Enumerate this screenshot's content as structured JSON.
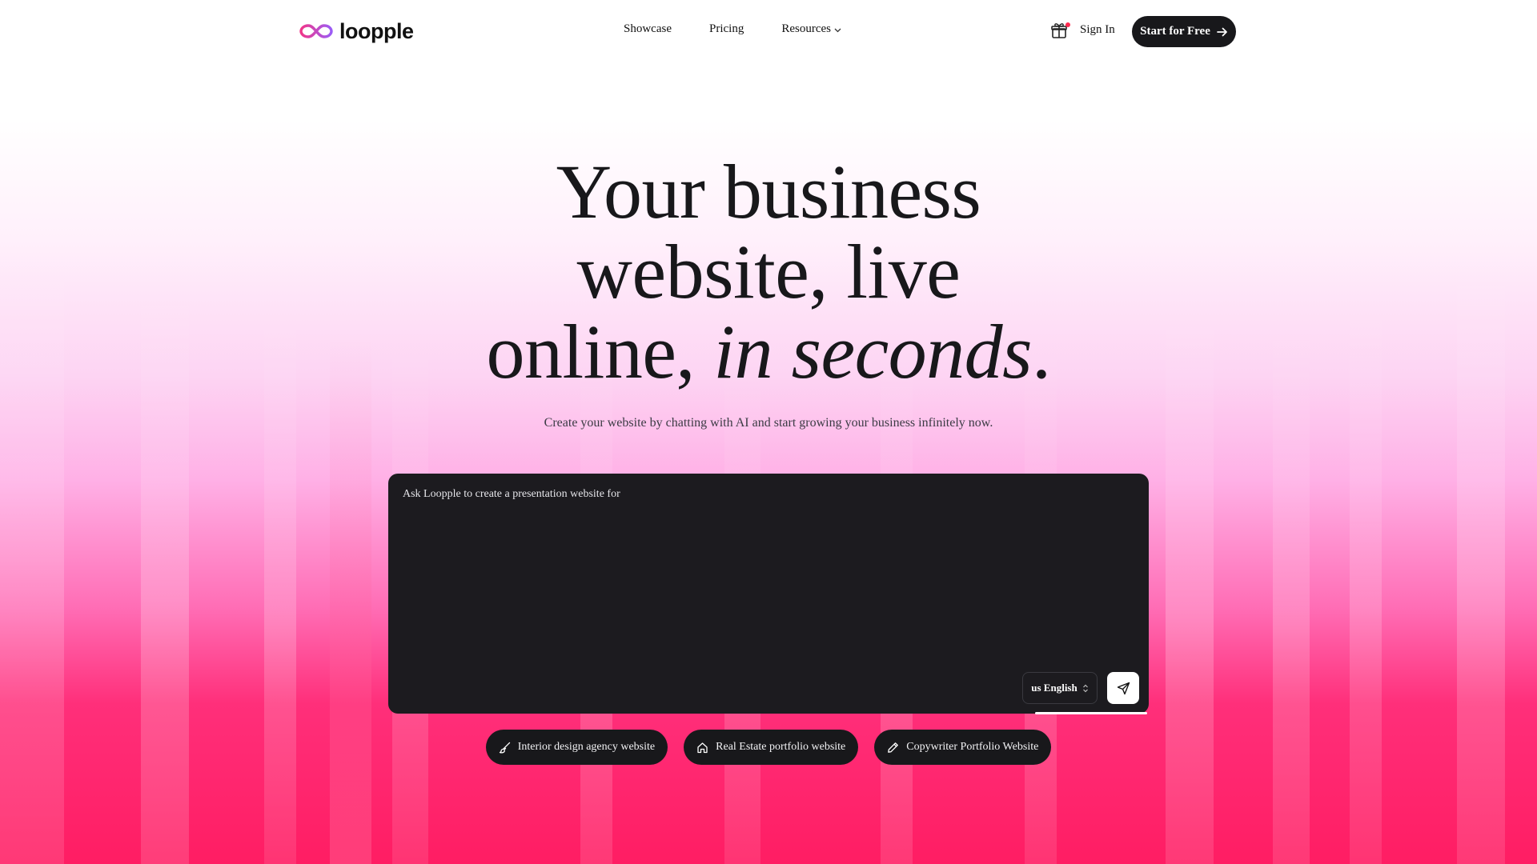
{
  "brand": {
    "name": "loopple"
  },
  "nav": {
    "items": [
      {
        "label": "Showcase"
      },
      {
        "label": "Pricing"
      },
      {
        "label": "Resources",
        "has_dropdown": true
      }
    ],
    "signin_label": "Sign In",
    "cta_label": "Start for Free"
  },
  "hero": {
    "line1": "Your business",
    "line2": "website, live",
    "line3_plain": "online, ",
    "line3_italic": "in seconds",
    "line3_end": ".",
    "subtitle": "Create your website by chatting with AI and start growing your business infinitely now."
  },
  "prompt": {
    "placeholder": "Ask Loopple to create a presentation website for",
    "language": "us English"
  },
  "suggestions": [
    {
      "label": "Interior design agency website",
      "icon": "brush-icon"
    },
    {
      "label": "Real Estate portfolio website",
      "icon": "home-icon"
    },
    {
      "label": "Copywriter Portfolio Website",
      "icon": "pen-icon"
    }
  ],
  "colors": {
    "accent": "#ff1d63",
    "dark": "#18181b",
    "logo_pink": "#e0328c",
    "logo_purple": "#9b5cf6"
  }
}
